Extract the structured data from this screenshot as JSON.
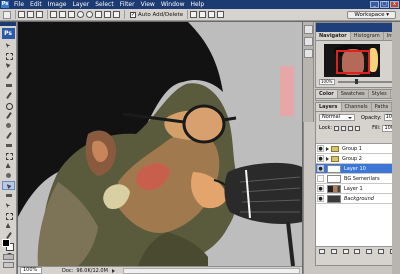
{
  "menubar": {
    "logo": "Ps",
    "items": [
      "File",
      "Edit",
      "Image",
      "Layer",
      "Select",
      "Filter",
      "View",
      "Window",
      "Help"
    ],
    "window_buttons": [
      "_",
      "□",
      "x"
    ]
  },
  "options": {
    "auto_add_delete_label": "Auto Add/Delete",
    "auto_add_delete_checked": "✓",
    "workspace_label": "Workspace ▾"
  },
  "toolbox": {
    "logo": "Ps"
  },
  "status": {
    "zoom": "100%",
    "doc_label": "Doc:",
    "doc_info": "96.0K/12.0M"
  },
  "panels": {
    "top_tabs": [
      "Navigator",
      "Histogram",
      "Info"
    ],
    "navigator_zoom": "100%",
    "color_tabs": [
      "Color",
      "Swatches",
      "Styles"
    ],
    "layers_tabs": [
      "Layers",
      "Channels",
      "Paths"
    ],
    "blend_mode": "Normal",
    "opacity_label": "Opacity:",
    "opacity_value": "100%",
    "lock_label": "Lock:",
    "fill_label": "Fill:",
    "fill_value": "100%"
  },
  "layers": [
    {
      "name": "Group 1",
      "kind": "group",
      "selected": false
    },
    {
      "name": "Group 2",
      "kind": "group",
      "selected": false
    },
    {
      "name": "Layer 10",
      "kind": "layer",
      "selected": true
    },
    {
      "name": "BG Semerilars",
      "kind": "layer",
      "selected": false
    },
    {
      "name": "Layer 1",
      "kind": "layer",
      "selected": false
    },
    {
      "name": "Background",
      "kind": "layer",
      "selected": false
    }
  ]
}
